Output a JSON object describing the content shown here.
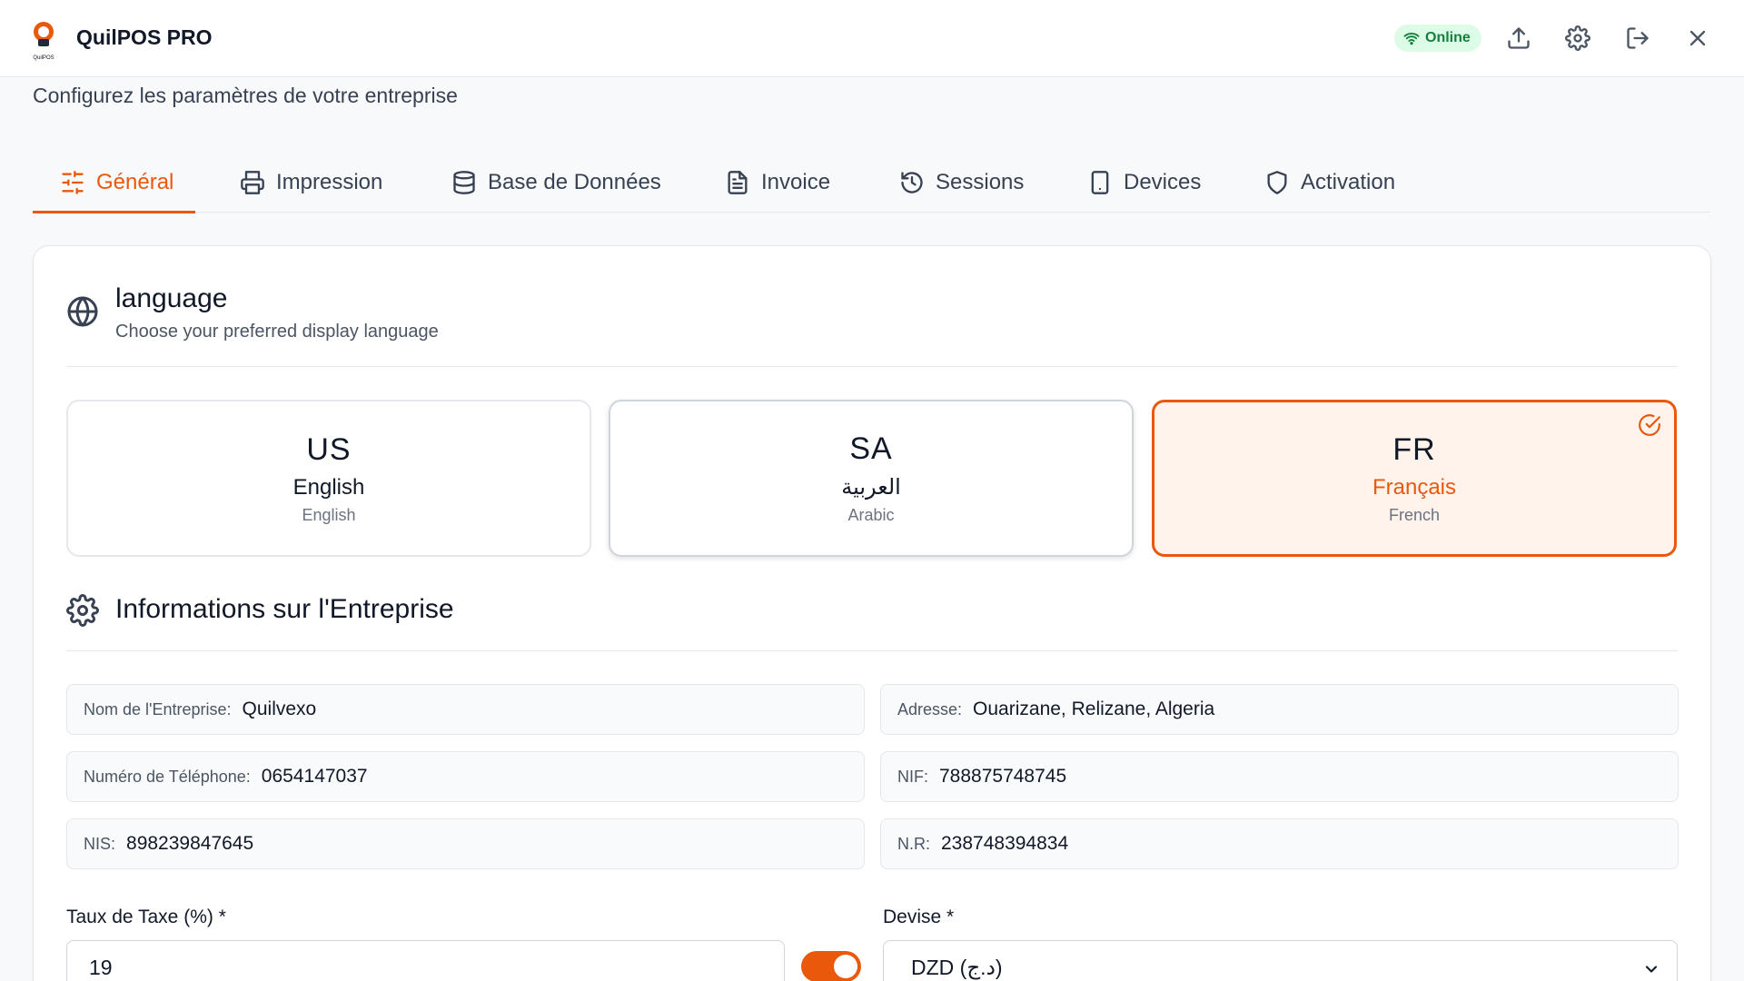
{
  "app": {
    "title": "QuilPOS PRO",
    "status": "Online",
    "logo_text": "QuilPOS"
  },
  "page": {
    "subtitle": "Configurez les paramètres de votre entreprise"
  },
  "tabs": [
    {
      "label": "Général",
      "icon": "sliders-icon",
      "active": true
    },
    {
      "label": "Impression",
      "icon": "printer-icon"
    },
    {
      "label": "Base de Données",
      "icon": "database-icon"
    },
    {
      "label": "Invoice",
      "icon": "file-text-icon"
    },
    {
      "label": "Sessions",
      "icon": "history-icon"
    },
    {
      "label": "Devices",
      "icon": "tablet-icon"
    },
    {
      "label": "Activation",
      "icon": "shield-icon"
    }
  ],
  "language_section": {
    "title": "language",
    "description": "Choose your preferred display language",
    "options": [
      {
        "code": "US",
        "native": "English",
        "english": "English",
        "selected": false
      },
      {
        "code": "SA",
        "native": "العربية",
        "english": "Arabic",
        "selected": false
      },
      {
        "code": "FR",
        "native": "Français",
        "english": "French",
        "selected": true
      }
    ]
  },
  "company_section": {
    "title": "Informations sur l'Entreprise",
    "fields": [
      {
        "label": "Nom de l'Entreprise:",
        "value": "Quilvexo"
      },
      {
        "label": "Adresse:",
        "value": "Ouarizane, Relizane, Algeria"
      },
      {
        "label": "Numéro de Téléphone:",
        "value": "0654147037"
      },
      {
        "label": "NIF:",
        "value": "788875748745"
      },
      {
        "label": "NIS:",
        "value": "898239847645"
      },
      {
        "label": "N.R:",
        "value": "238748394834"
      }
    ]
  },
  "tax": {
    "label": "Taux de Taxe (%) *",
    "value": "19",
    "enabled": true
  },
  "currency": {
    "label": "Devise *",
    "value": "DZD (د.ج)"
  },
  "colors": {
    "accent": "#ea580c",
    "online_bg": "#dcfce7",
    "online_text": "#15803d"
  }
}
